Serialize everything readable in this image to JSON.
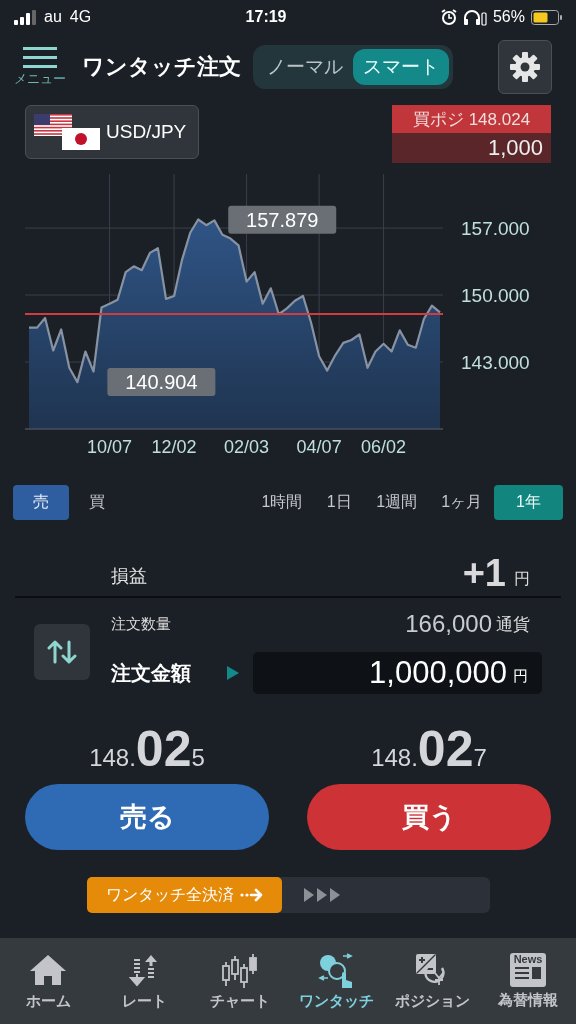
{
  "status_bar": {
    "carrier": "au",
    "network": "4G",
    "time": "17:19",
    "battery": "56%"
  },
  "header": {
    "menu_label": "メニュー",
    "title": "ワンタッチ注文",
    "mode_tabs": [
      {
        "label": "ノーマル",
        "selected": false
      },
      {
        "label": "スマート",
        "selected": true
      }
    ]
  },
  "currency_pair": "USD/JPY",
  "position": {
    "label": "買ポジ 148.024",
    "amount": "1,000"
  },
  "chart": {
    "chart_data": {
      "type": "area",
      "ylim": [
        136,
        162.65
      ],
      "grid": true,
      "categories": [
        null,
        null,
        null,
        null,
        null,
        null,
        null,
        null,
        null,
        null,
        "10/07",
        null,
        null,
        null,
        null,
        null,
        null,
        null,
        "12/02",
        null,
        null,
        null,
        null,
        null,
        null,
        null,
        null,
        "02/03",
        null,
        null,
        null,
        null,
        null,
        null,
        null,
        null,
        "04/07",
        null,
        null,
        null,
        null,
        null,
        null,
        null,
        "06/02",
        null,
        null,
        null,
        null,
        null,
        null,
        null
      ],
      "values": [
        146.6,
        146.6,
        147.6,
        144.2,
        146.4,
        142.4,
        140.9,
        144.1,
        142.0,
        148.7,
        149.1,
        149.5,
        152.4,
        153.0,
        152.6,
        154.4,
        154.9,
        149.6,
        149.9,
        153.7,
        156.5,
        157.9,
        157.3,
        157.8,
        156.3,
        155.9,
        155.2,
        151.4,
        152.4,
        149.1,
        150.7,
        148.0,
        148.6,
        149.4,
        149.9,
        147.1,
        143.6,
        142.1,
        143.7,
        145.0,
        145.3,
        145.9,
        142.4,
        144.1,
        144.9,
        144.1,
        146.3,
        144.8,
        144.5,
        147.5,
        148.9,
        148.2
      ],
      "yticks": [
        {
          "value": 143,
          "label": "143.000"
        },
        {
          "value": 150,
          "label": "150.000"
        },
        {
          "value": 157,
          "label": "157.000"
        }
      ],
      "ref_lines": [
        {
          "axis": "y",
          "value": 148.024,
          "color": "#d23b3f"
        }
      ],
      "annotations": [
        "157.879",
        "140.904"
      ]
    }
  },
  "side_tabs": [
    {
      "label": "売",
      "selected": true
    },
    {
      "label": "買",
      "selected": false
    }
  ],
  "periods": [
    {
      "label": "1時間",
      "selected": false
    },
    {
      "label": "1日",
      "selected": false
    },
    {
      "label": "1週間",
      "selected": false
    },
    {
      "label": "1ヶ月",
      "selected": false
    },
    {
      "label": "1年",
      "selected": true
    }
  ],
  "profit": {
    "label": "損益",
    "value": "+1",
    "unit": "円"
  },
  "order": {
    "quantity_label": "注文数量",
    "quantity": "166,000",
    "quantity_unit": "通貨",
    "amount_label": "注文金額",
    "amount": "1,000,000",
    "amount_unit": "円"
  },
  "quotes": [
    {
      "head": "148.",
      "big": "02",
      "tail": "5",
      "button": "売る",
      "kind": "sell"
    },
    {
      "head": "148.",
      "big": "02",
      "tail": "7",
      "button": "買う",
      "kind": "buy"
    }
  ],
  "close_all": {
    "label": "ワンタッチ全決済"
  },
  "nav": [
    {
      "label": "ホーム",
      "selected": false
    },
    {
      "label": "レート",
      "selected": false
    },
    {
      "label": "チャート",
      "selected": false
    },
    {
      "label": "ワンタッチ",
      "selected": true
    },
    {
      "label": "ポジション",
      "selected": false
    },
    {
      "label": "為替情報",
      "selected": false,
      "icon_text": "News"
    }
  ]
}
